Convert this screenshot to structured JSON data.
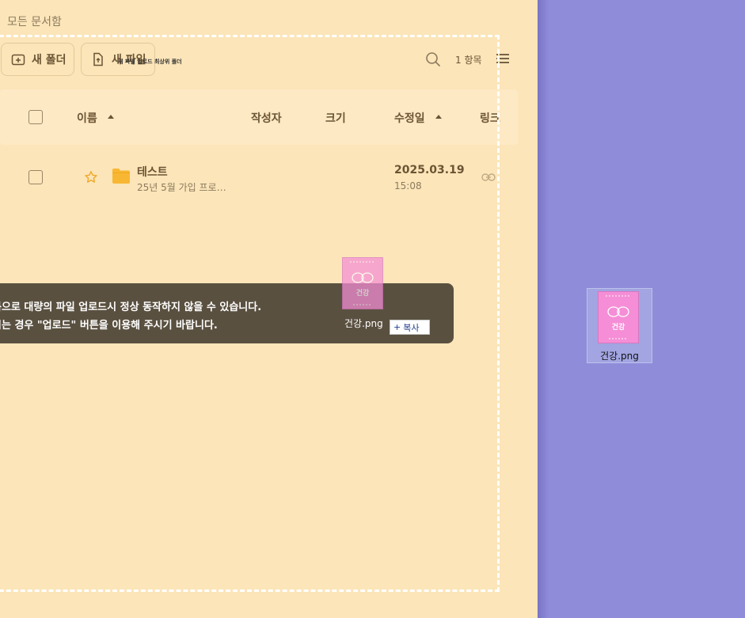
{
  "breadcrumb": "모든 문서함",
  "toolbar": {
    "new_folder_label": "새 폴더",
    "new_file_label": "새 파일",
    "tooltip_small": "새 파일 업로드 최상위 폴더",
    "item_count": "1 항목"
  },
  "table": {
    "headers": {
      "name": "이름",
      "author": "작성자",
      "size": "크기",
      "modified": "수정일",
      "link": "링크"
    },
    "rows": [
      {
        "title": "테스트",
        "subtitle": "25년 5월 가입 프로…",
        "date": "2025.03.19",
        "time": "15:08"
      }
    ]
  },
  "toast": {
    "line1": "름으로 대량의 파일 업로드시 정상 동작하지 않을 수 있습니다.",
    "line2": "시는 경우 \"업로드\" 버튼을 이용해 주시기 바랍니다."
  },
  "drag": {
    "filename": "건강.png",
    "copy_label": "복사",
    "thumb_text": "건강"
  },
  "desktop": {
    "filename": "건강.png",
    "thumb_text": "건강"
  },
  "colors": {
    "app_bg": "#fbe5b9",
    "desktop_bg": "#8f8cd9",
    "text_primary": "#6b5434",
    "folder_yellow": "#f8b732",
    "toast_bg": "#5a5040",
    "thumb_pink": "#f58ed6"
  }
}
